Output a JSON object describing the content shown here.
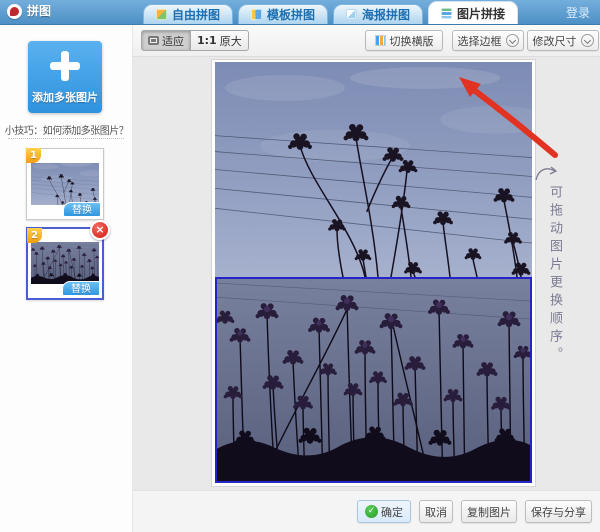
{
  "header": {
    "logo_text": "拼图",
    "login_label": "登录",
    "tabs": [
      {
        "label": "自由拼图"
      },
      {
        "label": "模板拼图"
      },
      {
        "label": "海报拼图"
      },
      {
        "label": "图片拼接"
      }
    ]
  },
  "sidebar": {
    "add_label": "添加多张图片",
    "tip_text": "小技巧：如何添加多张图片？",
    "thumbnails": [
      {
        "badge": "1",
        "replace_label": "替换"
      },
      {
        "badge": "2",
        "replace_label": "替换",
        "close_glyph": "×"
      }
    ]
  },
  "toolbar": {
    "fit_label": "适应",
    "original_prefix": "1:1",
    "original_label": "原大",
    "switch_horizontal_label": "切换横版",
    "select_border_label": "选择边框",
    "resize_label": "修改尺寸"
  },
  "workspace": {
    "annotation_text": "可拖动图片更换顺序。"
  },
  "footer": {
    "confirm_label": "确定",
    "cancel_label": "取消",
    "copy_label": "复制图片",
    "save_share_label": "保存与分享"
  },
  "icons": {
    "logo": "camera-flower-icon",
    "fit": "fit-screen-icon",
    "switch": "layout-columns-icon",
    "dropdown": "chevron-down-circle-icon",
    "confirm": "check-circle-icon",
    "close": "close-circle-icon",
    "annotation": "red-arrow-pointer"
  },
  "colors": {
    "header_blue": "#5b9ace",
    "tab_text_blue": "#1e6fb0",
    "accent_blue": "#3c9ce6",
    "selection_blue": "#2424c8",
    "badge_orange": "#f39c12",
    "confirm_green": "#2a9b2a",
    "close_red": "#cf1d14",
    "arrow_red": "#e23222",
    "workspace_gray": "#e9e9e9"
  }
}
